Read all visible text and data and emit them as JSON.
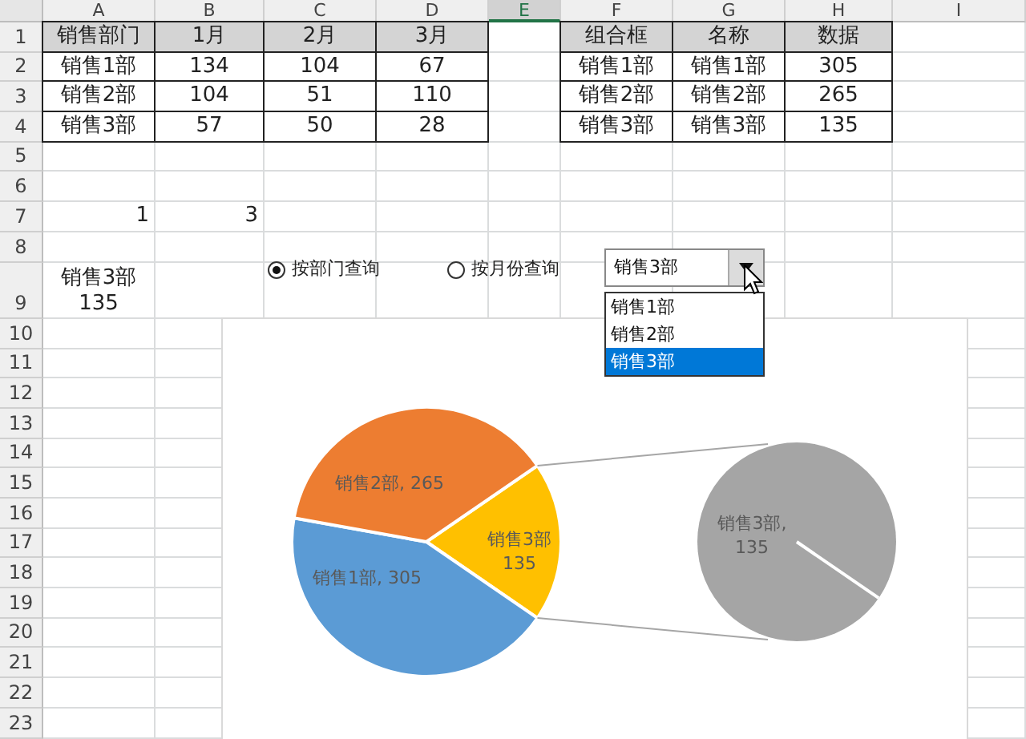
{
  "columns": [
    {
      "label": "A",
      "selected": false
    },
    {
      "label": "B",
      "selected": false
    },
    {
      "label": "C",
      "selected": false
    },
    {
      "label": "D",
      "selected": false
    },
    {
      "label": "E",
      "selected": true
    },
    {
      "label": "F",
      "selected": false
    },
    {
      "label": "G",
      "selected": false
    },
    {
      "label": "H",
      "selected": false
    },
    {
      "label": "I",
      "selected": false
    }
  ],
  "rows": [
    {
      "number": "1",
      "cells": [
        {
          "text": "销售部门",
          "kind": "header"
        },
        {
          "text": "1月",
          "kind": "header"
        },
        {
          "text": "2月",
          "kind": "header"
        },
        {
          "text": "3月",
          "kind": "header"
        },
        null,
        {
          "text": "组合框",
          "kind": "header"
        },
        {
          "text": "名称",
          "kind": "header"
        },
        {
          "text": "数据",
          "kind": "header"
        }
      ]
    },
    {
      "number": "2",
      "cells": [
        {
          "text": "销售1部",
          "kind": "data"
        },
        {
          "text": "134",
          "kind": "data"
        },
        {
          "text": "104",
          "kind": "data"
        },
        {
          "text": "67",
          "kind": "data"
        },
        null,
        {
          "text": "销售1部",
          "kind": "data"
        },
        {
          "text": "销售1部",
          "kind": "data"
        },
        {
          "text": "305",
          "kind": "data"
        }
      ]
    },
    {
      "number": "3",
      "cells": [
        {
          "text": "销售2部",
          "kind": "data"
        },
        {
          "text": "104",
          "kind": "data"
        },
        {
          "text": "51",
          "kind": "data"
        },
        {
          "text": "110",
          "kind": "data"
        },
        null,
        {
          "text": "销售2部",
          "kind": "data"
        },
        {
          "text": "销售2部",
          "kind": "data"
        },
        {
          "text": "265",
          "kind": "data"
        }
      ]
    },
    {
      "number": "4",
      "cells": [
        {
          "text": "销售3部",
          "kind": "data"
        },
        {
          "text": "57",
          "kind": "data"
        },
        {
          "text": "50",
          "kind": "data"
        },
        {
          "text": "28",
          "kind": "data"
        },
        null,
        {
          "text": "销售3部",
          "kind": "data"
        },
        {
          "text": "销售3部",
          "kind": "data"
        },
        {
          "text": "135",
          "kind": "data"
        }
      ]
    },
    {
      "number": "5"
    },
    {
      "number": "6"
    },
    {
      "number": "7",
      "cells": [
        {
          "text": "1",
          "kind": "number"
        },
        {
          "text": "3",
          "kind": "number"
        }
      ]
    },
    {
      "number": "8"
    },
    {
      "number": "9",
      "cells": [
        {
          "text": "销售3部\n135",
          "kind": "wrapped"
        }
      ]
    },
    {
      "number": "10"
    },
    {
      "number": "11"
    },
    {
      "number": "12"
    },
    {
      "number": "13"
    },
    {
      "number": "14"
    },
    {
      "number": "15"
    },
    {
      "number": "16"
    },
    {
      "number": "17"
    },
    {
      "number": "18"
    },
    {
      "number": "19"
    },
    {
      "number": "20"
    },
    {
      "number": "21"
    },
    {
      "number": "22"
    },
    {
      "number": "23"
    }
  ],
  "radio_options": [
    {
      "label": "按部门查询",
      "selected": true
    },
    {
      "label": "按月份查询",
      "selected": false
    }
  ],
  "combo_box": {
    "value": "销售3部",
    "expanded": true,
    "options": [
      {
        "text": "销售1部",
        "selected": false
      },
      {
        "text": "销售2部",
        "selected": false
      },
      {
        "text": "销售3部",
        "selected": true
      }
    ]
  },
  "chart": {
    "chart_data": {
      "type": "pie",
      "categories": [
        "销售1部",
        "销售2部",
        "销售3部"
      ],
      "values": [
        305,
        265,
        135
      ],
      "colors": [
        "#5b9bd5",
        "#ed7d31",
        "#ffc000"
      ],
      "value_labels": [
        "305",
        "265",
        "135"
      ]
    },
    "label_separator": ", ",
    "labels": [
      {
        "kind": "inline"
      },
      {
        "kind": "inline"
      },
      {
        "kind": "stacked"
      }
    ],
    "secondary_pie": {
      "color": "#a5a5a5",
      "label": [
        "销售3部,",
        "135"
      ]
    }
  }
}
